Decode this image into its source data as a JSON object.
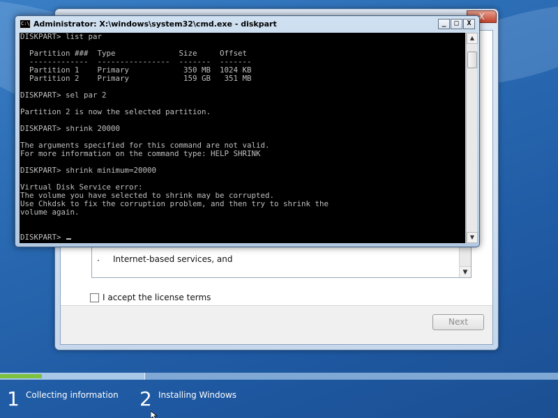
{
  "cmd": {
    "title": "Administrator: X:\\windows\\system32\\cmd.exe - diskpart",
    "icon": "C:\\",
    "buttons": {
      "minimize": "_",
      "maximize": "□",
      "close": "X"
    },
    "lines": [
      "DISKPART> list par",
      "",
      "  Partition ###  Type              Size     Offset",
      "  -------------  ----------------  -------  -------",
      "  Partition 1    Primary            350 MB  1024 KB",
      "  Partition 2    Primary            159 GB   351 MB",
      "",
      "DISKPART> sel par 2",
      "",
      "Partition 2 is now the selected partition.",
      "",
      "DISKPART> shrink 20000",
      "",
      "The arguments specified for this command are not valid.",
      "For more information on the command type: HELP SHRINK",
      "",
      "DISKPART> shrink minimum=20000",
      "",
      "Virtual Disk Service error:",
      "The volume you have selected to shrink may be corrupted.",
      "Use Chkdsk to fix the corruption problem, and then try to shrink the",
      "volume again.",
      "",
      ""
    ],
    "prompt": "DISKPART> "
  },
  "setup": {
    "close_label": "X",
    "license_bullet": "·",
    "license_visible_line": "Internet-based services, and",
    "accept_label": "I accept the license terms",
    "next_label": "Next"
  },
  "progress": {
    "fill_fraction": 0.29,
    "steps": [
      {
        "number": "1",
        "label": "Collecting information"
      },
      {
        "number": "2",
        "label": "Installing Windows"
      }
    ]
  },
  "colors": {
    "console_bg": "#000000",
    "console_fg": "#c0c0c0",
    "progress_fill": "#7cc23f",
    "desktop_bg": "#2a6bb3"
  }
}
